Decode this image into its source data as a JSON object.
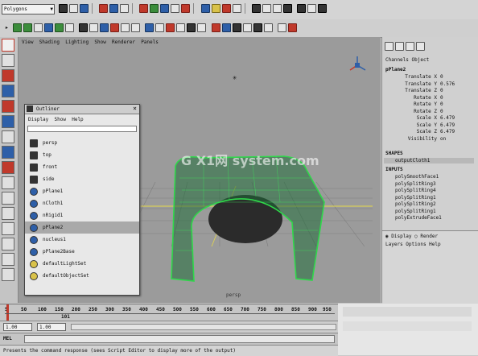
{
  "status_line": {
    "mode_menu": "Polygons"
  },
  "viewport": {
    "menu_items": [
      "View",
      "Shading",
      "Lighting",
      "Show",
      "Renderer",
      "Panels"
    ],
    "camera_label": "persp",
    "watermark": "G X1网 system.com"
  },
  "outliner": {
    "title": "Outliner",
    "menu": [
      "Display",
      "Show",
      "Help"
    ],
    "items": [
      {
        "label": "persp",
        "icon": "camera-icon",
        "selected": false
      },
      {
        "label": "top",
        "icon": "camera-icon",
        "selected": false
      },
      {
        "label": "front",
        "icon": "camera-icon",
        "selected": false
      },
      {
        "label": "side",
        "icon": "camera-icon",
        "selected": false
      },
      {
        "label": "pPlane1",
        "icon": "mesh-icon",
        "selected": false
      },
      {
        "label": "nCloth1",
        "icon": "ncloth-icon",
        "selected": false
      },
      {
        "label": "nRigid1",
        "icon": "nrigid-icon",
        "selected": false
      },
      {
        "label": "pPlane2",
        "icon": "mesh-icon",
        "selected": true
      },
      {
        "label": "nucleus1",
        "icon": "nucleus-icon",
        "selected": false
      },
      {
        "label": "pPlane2Base",
        "icon": "mesh-icon",
        "selected": false
      },
      {
        "label": "defaultLightSet",
        "icon": "set-icon",
        "selected": false
      },
      {
        "label": "defaultObjectSet",
        "icon": "set-icon",
        "selected": false
      }
    ]
  },
  "channel_box": {
    "header": "Channels  Object",
    "object_name": "pPlane2",
    "attributes": [
      {
        "name": "Translate X",
        "value": "0"
      },
      {
        "name": "Translate Y",
        "value": "0.576"
      },
      {
        "name": "Translate Z",
        "value": "0"
      },
      {
        "name": "Rotate X",
        "value": "0"
      },
      {
        "name": "Rotate Y",
        "value": "0"
      },
      {
        "name": "Rotate Z",
        "value": "0"
      },
      {
        "name": "Scale X",
        "value": "6.479"
      },
      {
        "name": "Scale Y",
        "value": "6.479"
      },
      {
        "name": "Scale Z",
        "value": "6.479"
      },
      {
        "name": "Visibility",
        "value": "on"
      }
    ],
    "shapes_label": "SHAPES",
    "shape_name": "outputCloth1",
    "inputs_label": "INPUTS",
    "inputs": [
      "polySmoothFace1",
      "polySplitRing3",
      "polySplitRing4",
      "polySplitRing1",
      "polySplitRing2",
      "polySplitRing1",
      "polyExtrudeFace1"
    ],
    "layer_tabs": [
      "Display",
      "Render"
    ],
    "layer_menu": "Layers  Options  Help"
  },
  "timeline": {
    "ticks": [
      "5",
      "50",
      "100",
      "150",
      "200",
      "250",
      "300",
      "350",
      "400",
      "450",
      "500",
      "550",
      "600",
      "650",
      "700",
      "750",
      "800",
      "850",
      "900",
      "950"
    ],
    "frame_marker": "101",
    "range_start": "1.00",
    "range_start2": "1.00"
  },
  "command_line": {
    "label": "MEL",
    "help_text": "Presents the command response (sees Script Editor to display more of the output)"
  },
  "colors": {
    "viewport_bg": "#9b9b9b",
    "mesh_green": "#2fd84a",
    "selection_highlight": "#a9a9a9"
  }
}
